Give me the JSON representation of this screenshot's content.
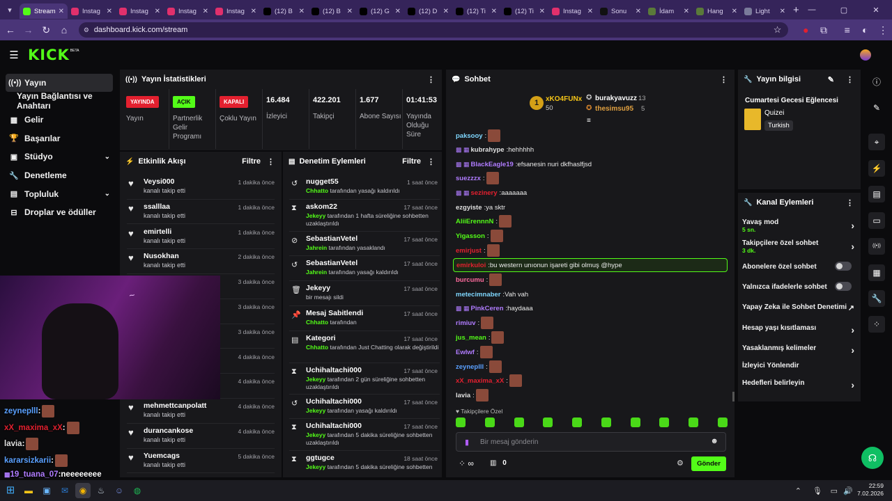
{
  "browser": {
    "tabs": [
      {
        "label": "Stream",
        "active": true,
        "icon": "kick-icon",
        "color": "#53fc18"
      },
      {
        "label": "Instag",
        "icon": "instagram-icon",
        "color": "#e1306c"
      },
      {
        "label": "Instag",
        "icon": "instagram-icon",
        "color": "#e1306c"
      },
      {
        "label": "Instag",
        "icon": "instagram-icon",
        "color": "#e1306c"
      },
      {
        "label": "Instag",
        "icon": "instagram-icon",
        "color": "#e1306c"
      },
      {
        "label": "(12) B",
        "icon": "x-icon",
        "color": "#000000"
      },
      {
        "label": "(12) B",
        "icon": "x-icon",
        "color": "#000000"
      },
      {
        "label": "(12) G",
        "icon": "x-icon",
        "color": "#000000"
      },
      {
        "label": "(12) D",
        "icon": "x-icon",
        "color": "#000000"
      },
      {
        "label": "(12) Ti",
        "icon": "x-icon",
        "color": "#000000"
      },
      {
        "label": "(12) Ti",
        "icon": "x-icon",
        "color": "#000000"
      },
      {
        "label": "Instag",
        "icon": "instagram-icon",
        "color": "#e1306c"
      },
      {
        "label": "Sonu",
        "icon": "tiktok-icon",
        "color": "#111111"
      },
      {
        "label": "İdam",
        "icon": "web-icon",
        "color": "#5a7a3a"
      },
      {
        "label": "Hang",
        "icon": "web-icon",
        "color": "#5a7a3a"
      },
      {
        "label": "Light",
        "icon": "web-icon",
        "color": "#7a7a9a"
      }
    ],
    "url": "dashboard.kick.com/stream"
  },
  "kick": {
    "logo": "KICK",
    "logo_sup": "BETA"
  },
  "sidebar": {
    "items": [
      {
        "label": "Yayın",
        "icon": "stream-icon"
      },
      {
        "label": "Yayın Bağlantısı ve Anahtarı",
        "icon": ""
      },
      {
        "label": "Gelir",
        "icon": "revenue-icon"
      },
      {
        "label": "Başarılar",
        "icon": "trophy-icon"
      },
      {
        "label": "Stüdyo",
        "icon": "studio-icon",
        "chevron": true
      },
      {
        "label": "Denetleme",
        "icon": "wrench-icon"
      },
      {
        "label": "Topluluk",
        "icon": "community-icon",
        "chevron": true
      },
      {
        "label": "Droplar ve ödüller",
        "icon": "gift-icon"
      }
    ]
  },
  "stats": {
    "title": "Yayın İstatistikleri",
    "items": [
      {
        "badge": "YAYINDA",
        "badge_color": "#e3202f",
        "label": "Yayın"
      },
      {
        "badge": "AÇIK",
        "badge_color": "#53fc18",
        "label": "Partnerlik Gelir Programı"
      },
      {
        "badge": "KAPALI",
        "badge_color": "#e3202f",
        "label": "Çoklu Yayın"
      },
      {
        "value": "16.484",
        "label": "İzleyici"
      },
      {
        "value": "422.201",
        "label": "Takipçi"
      },
      {
        "value": "1.677",
        "label": "Abone Sayısı"
      },
      {
        "value": "01:41:53",
        "label": "Yayında Olduğu Süre"
      }
    ]
  },
  "activity": {
    "title": "Etkinlik Akışı",
    "filter": "Filtre",
    "rows": [
      {
        "name": "Veysi000",
        "sub": "kanalı takip etti",
        "time": "1 dakika önce"
      },
      {
        "name": "ssalllaa",
        "sub": "kanalı takip etti",
        "time": "1 dakika önce"
      },
      {
        "name": "emirtelli",
        "sub": "kanalı takip etti",
        "time": "1 dakika önce"
      },
      {
        "name": "Nusokhan",
        "sub": "kanalı takip etti",
        "time": "2 dakika önce"
      },
      {
        "name": "",
        "sub": "",
        "time": "3 dakika önce"
      },
      {
        "name": "",
        "sub": "",
        "time": "3 dakika önce"
      },
      {
        "name": "",
        "sub": "",
        "time": "3 dakika önce"
      },
      {
        "name": "",
        "sub": "",
        "time": "4 dakika önce"
      },
      {
        "name": "",
        "sub": "",
        "time": "4 dakika önce"
      },
      {
        "name": "mehmettcanpolatt",
        "sub": "kanalı takip etti",
        "time": "4 dakika önce"
      },
      {
        "name": "durancankose",
        "sub": "kanalı takip etti",
        "time": "4 dakika önce"
      },
      {
        "name": "Yuemcags",
        "sub": "kanalı takip etti",
        "time": "5 dakika önce"
      }
    ]
  },
  "moderation": {
    "title": "Denetim Eylemleri",
    "filter": "Filtre",
    "rows": [
      {
        "icon": "unban-icon",
        "glyph": "↺",
        "name": "nugget55",
        "actor": "Chhatto",
        "text": " tarafından yasağı kaldırıldı",
        "time": "1 saat önce",
        "h": 36
      },
      {
        "icon": "timeout-icon",
        "glyph": "⧗",
        "name": "askom22",
        "actor": "Jekeyy",
        "text": " tarafından 1 hafta süreliğine sohbetten uzaklaştırıldı",
        "time": "17 saat önce",
        "h": 46
      },
      {
        "icon": "ban-icon",
        "glyph": "⊘",
        "name": "SebastianVetel",
        "actor": "Jahrein",
        "text": " tarafından yasaklandı",
        "time": "17 saat önce",
        "h": 35
      },
      {
        "icon": "unban-icon",
        "glyph": "↺",
        "name": "SebastianVetel",
        "actor": "Jahrein",
        "text": " tarafından yasağı kaldırıldı",
        "time": "17 saat önce",
        "h": 36
      },
      {
        "icon": "trash-icon",
        "glyph": "🗑",
        "name": "Jekeyy",
        "actor": "",
        "text": "bir mesajı sildi",
        "time": "17 saat önce",
        "h": 36
      },
      {
        "icon": "pin-icon",
        "glyph": "📌",
        "name": "Mesaj Sabitlendi",
        "actor": "Chhatto",
        "text": " tarafından",
        "time": "17 saat önce",
        "h": 36
      },
      {
        "icon": "category-icon",
        "glyph": "▤",
        "name": "Kategori",
        "actor": "Chhatto",
        "text": " tarafından Just Chatting olarak değiştirildi",
        "time": "17 saat önce",
        "h": 46
      },
      {
        "icon": "timeout-icon",
        "glyph": "⧗",
        "name": "Uchihaltachi000",
        "actor": "Jekeyy",
        "text": " tarafından 2 gün süreliğine sohbetten uzaklaştırıldı",
        "time": "17 saat önce",
        "h": 45
      },
      {
        "icon": "unban-icon",
        "glyph": "↺",
        "name": "Uchihaltachi000",
        "actor": "Jekeyy",
        "text": " tarafından yasağı kaldırıldı",
        "time": "17 saat önce",
        "h": 35
      },
      {
        "icon": "timeout-icon",
        "glyph": "⧗",
        "name": "Uchihaltachi000",
        "actor": "Jekeyy",
        "text": " tarafından 5 dakika süreliğine sohbetten uzaklaştırıldı",
        "time": "17 saat önce",
        "h": 46
      },
      {
        "icon": "timeout-icon",
        "glyph": "⧗",
        "name": "ggtugce",
        "actor": "Jekeyy",
        "text": " tarafından 5 dakika süreliğine sohbetten",
        "time": "18 saat önce",
        "h": 30
      }
    ]
  },
  "chat": {
    "title": "Sohbet",
    "leaderboard": [
      {
        "rank": "1",
        "name": "xKO4FUNx",
        "score": "50"
      },
      {
        "name": "burakyavuzz",
        "score": "13"
      },
      {
        "name": "thesimsu95",
        "score": "5"
      }
    ],
    "messages": [
      {
        "user": "paksooy",
        "color": "#7fd7ff",
        "text": "",
        "emote": true
      },
      {
        "user": "kubrahype",
        "color": "#e0e0e0",
        "text": "hehhhhh",
        "badges": true
      },
      {
        "user": "BlackEagle19",
        "color": "#b07cff",
        "text": "efsanesin nuri dkfhaslfjsd",
        "badges": true
      },
      {
        "user": "suezzzx",
        "color": "#b07cff",
        "text": "",
        "emote": true
      },
      {
        "user": "sezinery",
        "color": "#e3202f",
        "text": "aaaaaaa",
        "badges": true
      },
      {
        "user": "ezgyiste",
        "color": "#e0e0e0",
        "text": "ya sktr"
      },
      {
        "user": "AliiErennnN",
        "color": "#53fc18",
        "text": "",
        "emote": true
      },
      {
        "user": "Yigasson",
        "color": "#53fc18",
        "text": "",
        "emote": true
      },
      {
        "user": "emirjust",
        "color": "#e3202f",
        "text": "",
        "emote": true
      },
      {
        "user": "emirkuloi",
        "color": "#e3202f",
        "text": "bu western unıonun işareti gibi olmuş @hype",
        "highlight": true
      },
      {
        "user": "burcumu",
        "color": "#ff6b9d",
        "text": "",
        "emote": true
      },
      {
        "user": "metecimnaber",
        "color": "#7fd7ff",
        "text": "Vah vah"
      },
      {
        "user": "PinkCeren",
        "color": "#b07cff",
        "text": "haydaaa",
        "badges": true
      },
      {
        "user": "rimiuv",
        "color": "#b07cff",
        "text": "",
        "emote": true
      },
      {
        "user": "jus_mean",
        "color": "#53fc18",
        "text": "",
        "emote": true
      },
      {
        "user": "Ewlwf",
        "color": "#b07cff",
        "text": "",
        "emote": true
      },
      {
        "user": "zeyneplll",
        "color": "#5aa0ff",
        "text": "",
        "emote": true
      },
      {
        "user": "xX_maxima_xX",
        "color": "#e3202f",
        "text": "",
        "emote": true
      },
      {
        "user": "lavia",
        "color": "#e0e0e0",
        "text": "",
        "emote": true
      }
    ],
    "followers_only": "Takipçilere Özel",
    "input_placeholder": "Bir mesaj gönderin",
    "points": "∞",
    "store_count": "0",
    "send_label": "Gönder"
  },
  "stream_info": {
    "title": "Yayın bilgisi",
    "stream_title": "Cumartesi Gecesi Eğlencesi",
    "category": "Quizei",
    "tag": "Turkish"
  },
  "channel_actions": {
    "title": "Kanal Eylemleri",
    "items": [
      {
        "label": "Yavaş mod",
        "sub": "5 sn.",
        "kind": "arrow"
      },
      {
        "label": "Takipçilere özel sohbet",
        "sub": "3 dk.",
        "kind": "arrow"
      },
      {
        "label": "Abonelere özel sohbet",
        "sub": "",
        "kind": "toggle"
      },
      {
        "label": "Yalnızca ifadelerle sohbet",
        "sub": "",
        "kind": "toggle"
      },
      {
        "label": "Yapay Zeka ile Sohbet Denetimi",
        "sub": "",
        "kind": "external"
      },
      {
        "label": "Hesap yaşı kısıtlaması",
        "sub": "",
        "kind": "arrow"
      },
      {
        "label": "Yasaklanmış kelimeler",
        "sub": "",
        "kind": "arrow"
      },
      {
        "label": "İzleyici Yönlendir",
        "sub": "",
        "kind": "none"
      },
      {
        "label": "Hedefleri belirleyin",
        "sub": "",
        "kind": "arrow"
      }
    ]
  },
  "overlay_chat": [
    {
      "user": "zeyneplll",
      "color": "#5aa0ff"
    },
    {
      "user": "xX_maxima_xX",
      "color": "#e3202f"
    },
    {
      "user": "lavia",
      "color": "#e0e0e0"
    },
    {
      "user": "kararsizkarii",
      "color": "#5aa0ff"
    },
    {
      "user": "19_tuana_07",
      "color": "#b07cff",
      "text": "neeeeeeee"
    }
  ],
  "taskbar": {
    "time": "22:59",
    "date": "7.02.2026"
  },
  "colors": {
    "accent": "#53fc18",
    "live": "#e3202f",
    "panel": "#18181b",
    "bg": "#0b0b0d"
  }
}
